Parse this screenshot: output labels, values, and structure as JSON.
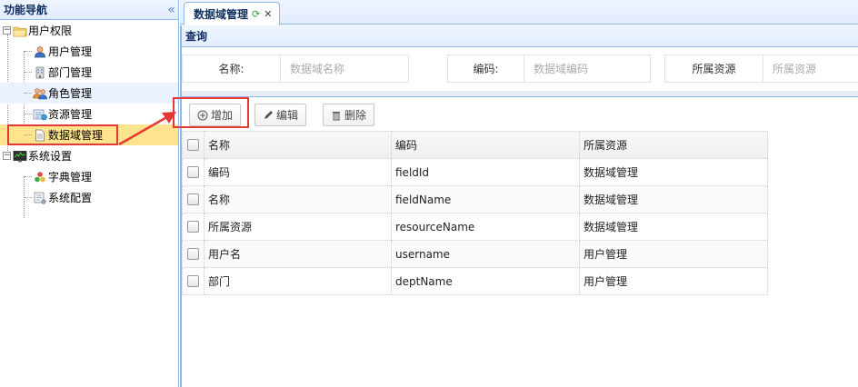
{
  "sidebar": {
    "title": "功能导航",
    "collapse_glyph": "«",
    "tree": [
      {
        "label": "用户权限",
        "icon": "folder-icon",
        "level": 0
      },
      {
        "label": "用户管理",
        "icon": "user-icon",
        "level": 1
      },
      {
        "label": "部门管理",
        "icon": "building-icon",
        "level": 1
      },
      {
        "label": "角色管理",
        "icon": "role-group-icon",
        "level": 1
      },
      {
        "label": "资源管理",
        "icon": "resource-icon",
        "level": 1
      },
      {
        "label": "数据域管理",
        "icon": "document-icon",
        "level": 1,
        "selected": true
      },
      {
        "label": "系统设置",
        "icon": "monitor-icon",
        "level": 0
      },
      {
        "label": "字典管理",
        "icon": "dictionary-icon",
        "level": 1
      },
      {
        "label": "系统配置",
        "icon": "config-icon",
        "level": 1
      }
    ]
  },
  "tabs": [
    {
      "label": "数据域管理"
    }
  ],
  "query": {
    "title": "查询",
    "fields": [
      {
        "label": "名称:",
        "placeholder": "数据域名称"
      },
      {
        "label": "编码:",
        "placeholder": "数据域编码"
      },
      {
        "label": "所属资源",
        "placeholder": "所属资源"
      }
    ]
  },
  "toolbar": {
    "add_label": "增加",
    "edit_label": "编辑",
    "delete_label": "删除"
  },
  "grid": {
    "columns": [
      "名称",
      "编码",
      "所属资源"
    ],
    "rows": [
      [
        "编码",
        "fieldId",
        "数据域管理"
      ],
      [
        "名称",
        "fieldName",
        "数据域管理"
      ],
      [
        "所属资源",
        "resourceName",
        "数据域管理"
      ],
      [
        "用户名",
        "username",
        "用户管理"
      ],
      [
        "部门",
        "deptName",
        "用户管理"
      ]
    ]
  },
  "colors": {
    "accent_border": "#95b8e7",
    "selection": "#ffe48d",
    "highlight_red": "#e53935"
  }
}
